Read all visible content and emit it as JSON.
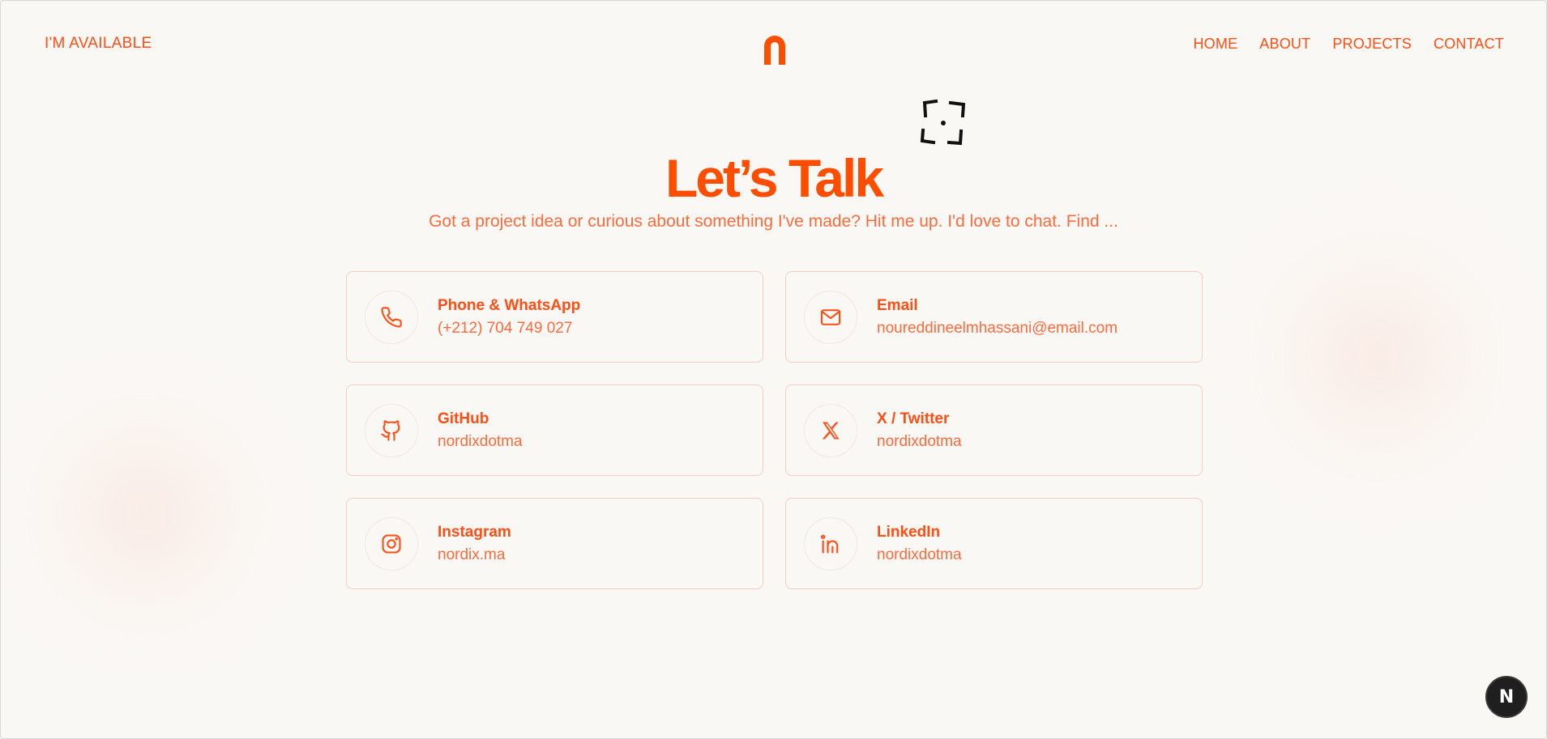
{
  "header": {
    "availability": "I'M AVAILABLE",
    "nav": [
      "HOME",
      "ABOUT",
      "PROJECTS",
      "CONTACT"
    ]
  },
  "hero": {
    "title": "Let’s Talk",
    "subtitle": "Got a project idea or curious about something I've made? Hit me up. I'd love to chat. Find ..."
  },
  "contacts": [
    {
      "label": "Phone & WhatsApp",
      "value": "(+212) 704 749 027",
      "icon": "phone-icon"
    },
    {
      "label": "Email",
      "value": "noureddineelmhassani@email.com",
      "icon": "mail-icon"
    },
    {
      "label": "GitHub",
      "value": "nordixdotma",
      "icon": "github-icon"
    },
    {
      "label": "X / Twitter",
      "value": "nordixdotma",
      "icon": "x-icon"
    },
    {
      "label": "Instagram",
      "value": "nordix.ma",
      "icon": "instagram-icon"
    },
    {
      "label": "LinkedIn",
      "value": "nordixdotma",
      "icon": "linkedin-icon"
    }
  ],
  "badge": {
    "letter": "N"
  },
  "colors": {
    "accent": "#ff4d14",
    "background": "#faf8f5",
    "card_border": "#f6cdbd",
    "badge_bg": "#1f1f1f"
  }
}
